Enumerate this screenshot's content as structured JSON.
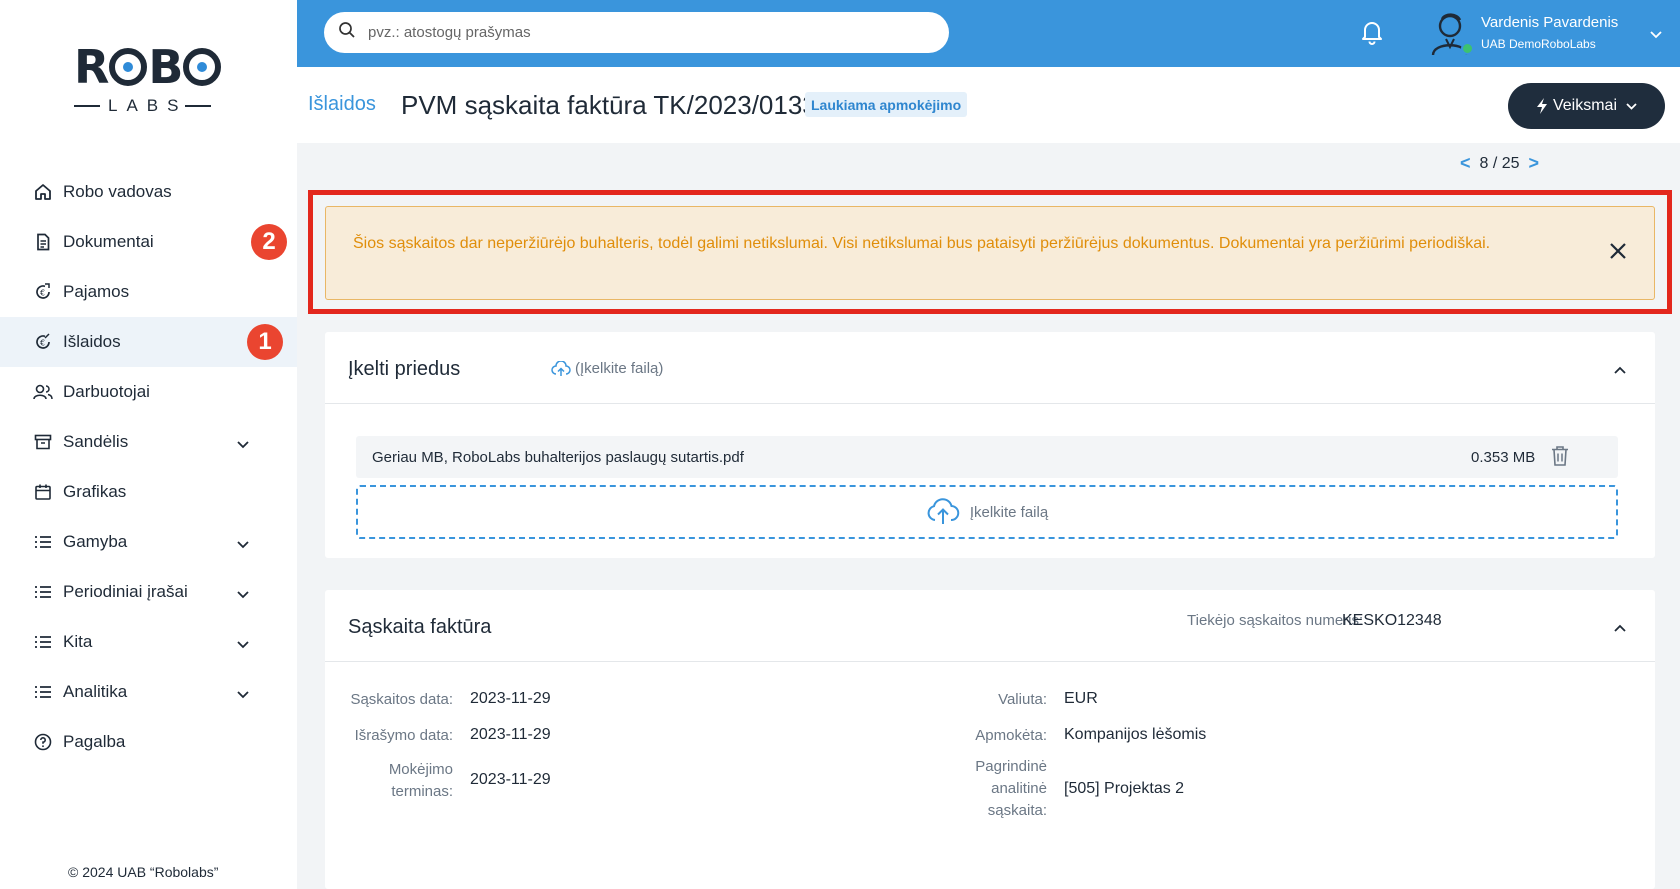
{
  "sidebar": {
    "logo_top": "ROBO",
    "logo_sub": "LABS",
    "items": [
      {
        "label": "Robo vadovas",
        "icon": "home-icon"
      },
      {
        "label": "Dokumentai",
        "icon": "document-icon"
      },
      {
        "label": "Pajamos",
        "icon": "income-icon"
      },
      {
        "label": "Išlaidos",
        "icon": "expense-icon"
      },
      {
        "label": "Darbuotojai",
        "icon": "users-icon"
      },
      {
        "label": "Sandėlis",
        "icon": "archive-icon"
      },
      {
        "label": "Grafikas",
        "icon": "calendar-icon"
      },
      {
        "label": "Gamyba",
        "icon": "list-icon"
      },
      {
        "label": "Periodiniai įrašai",
        "icon": "list-icon"
      },
      {
        "label": "Kita",
        "icon": "list-icon"
      },
      {
        "label": "Analitika",
        "icon": "list-icon"
      },
      {
        "label": "Pagalba",
        "icon": "help-icon"
      }
    ],
    "step_badges": [
      "1",
      "2"
    ],
    "copyright": "© 2024 UAB “Robolabs”"
  },
  "topbar": {
    "search_placeholder": "pvz.: atostogų prašymas",
    "user_name": "Vardenis Pavardenis",
    "user_company": "UAB DemoRoboLabs"
  },
  "header": {
    "breadcrumb": "Išlaidos",
    "title": "PVM sąskaita faktūra TK/2023/0133",
    "status": "Laukiama apmokėjimo",
    "actions_label": "Veiksmai"
  },
  "pager": {
    "text": "8 / 25",
    "prev": "<",
    "next": ">"
  },
  "alert": {
    "text": "Šios sąskaitos dar neperžiūrėjo buhalteris, todėl galimi netikslumai. Visi netikslumai bus pataisyti peržiūrėjus dokumentus. Dokumentai yra peržiūrimi periodiškai."
  },
  "attachments": {
    "title": "Įkelti priedus",
    "upload_link": "(Įkelkite failą)",
    "file_name": "Geriau MB, RoboLabs buhalterijos paslaugų sutartis.pdf",
    "file_size": "0.353 MB",
    "dropzone_label": "Įkelkite failą"
  },
  "invoice": {
    "title": "Sąskaita faktūra",
    "supplier_label": "Tiekėjo sąskaitos numeris:",
    "supplier_value": "KESKO12348",
    "invoice_date_label": "Sąskaitos data:",
    "invoice_date": "2023-11-29",
    "issue_date_label": "Išrašymo data:",
    "issue_date": "2023-11-29",
    "due_label_1": "Mokėjimo",
    "due_label_2": "terminas:",
    "due_date": "2023-11-29",
    "currency_label": "Valiuta:",
    "currency": "EUR",
    "paid_label": "Apmokėta:",
    "paid": "Kompanijos lėšomis",
    "analytic_label_1": "Pagrindinė",
    "analytic_label_2": "analitinė",
    "analytic_label_3": "sąskaita:",
    "analytic": "[505] Projektas 2"
  },
  "colors": {
    "accent": "#3a95dc",
    "dark": "#1f2d3d",
    "warning": "#e08e0b",
    "highlight": "#e3271d",
    "badge": "#ea4530"
  }
}
